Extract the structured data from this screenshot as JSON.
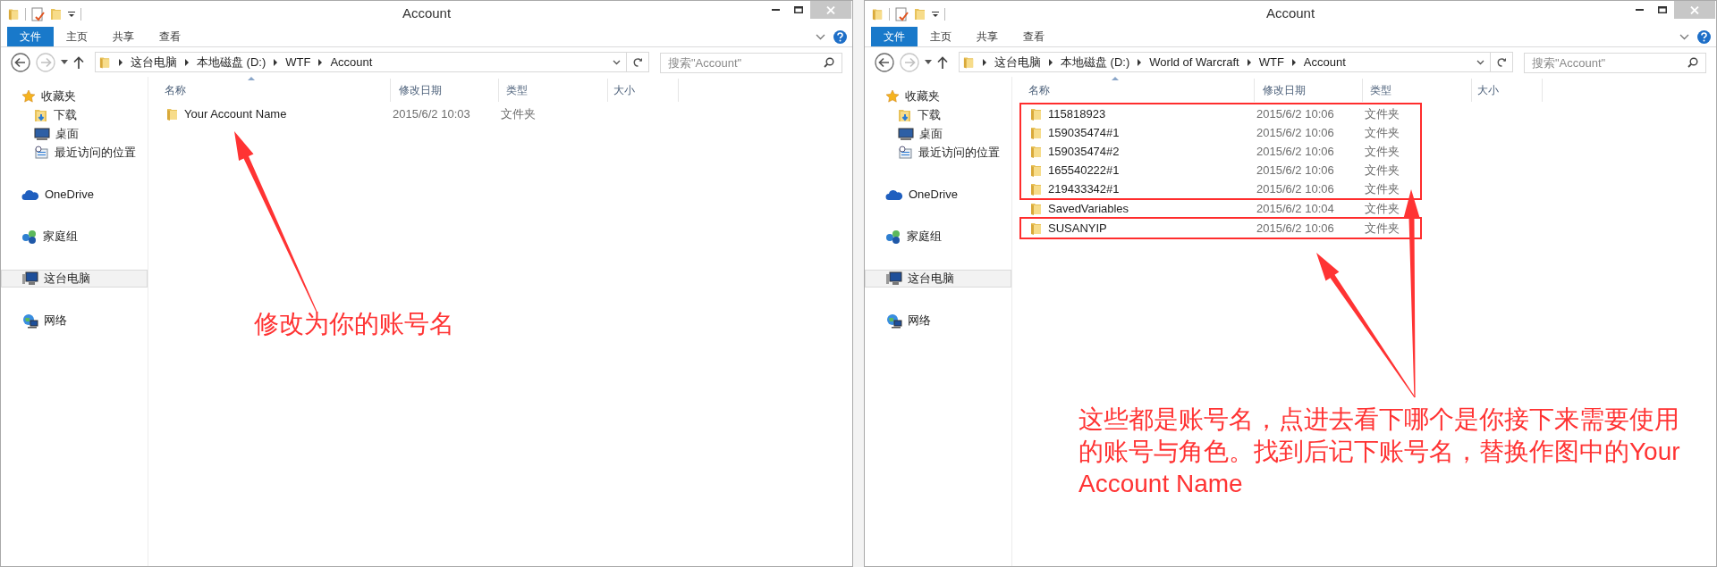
{
  "windows": [
    {
      "title": "Account",
      "ribbon_tabs": [
        {
          "label": "文件",
          "kind": "file"
        },
        {
          "label": "主页",
          "kind": "tab"
        },
        {
          "label": "共享",
          "kind": "tab"
        },
        {
          "label": "查看",
          "kind": "tab"
        }
      ],
      "path": [
        "这台电脑",
        "本地磁盘 (D:)",
        "WTF",
        "Account"
      ],
      "search": {
        "placeholder": "搜索\"Account\""
      },
      "columns": [
        "名称",
        "修改日期",
        "类型",
        "大小"
      ],
      "sidebar": [
        {
          "label": "收藏夹",
          "kind": "favorites",
          "selected": false,
          "children": [
            {
              "label": "下载",
              "kind": "downloads",
              "selected": false
            },
            {
              "label": "桌面",
              "kind": "desktop",
              "selected": false
            },
            {
              "label": "最近访问的位置",
              "kind": "recent",
              "selected": false
            }
          ]
        },
        {
          "label": "OneDrive",
          "kind": "cloud",
          "selected": false
        },
        {
          "label": "家庭组",
          "kind": "homegroup",
          "selected": false
        },
        {
          "label": "这台电脑",
          "kind": "computer",
          "selected": true
        },
        {
          "label": "网络",
          "kind": "network",
          "selected": false
        }
      ],
      "files": [
        {
          "name": "Your Account Name",
          "modified": "2015/6/2 10:03",
          "type": "文件夹",
          "boxed": false
        }
      ]
    },
    {
      "title": "Account",
      "ribbon_tabs": [
        {
          "label": "文件",
          "kind": "file"
        },
        {
          "label": "主页",
          "kind": "tab"
        },
        {
          "label": "共享",
          "kind": "tab"
        },
        {
          "label": "查看",
          "kind": "tab"
        }
      ],
      "path": [
        "这台电脑",
        "本地磁盘 (D:)",
        "World of Warcraft",
        "WTF",
        "Account"
      ],
      "search": {
        "placeholder": "搜索\"Account\""
      },
      "columns": [
        "名称",
        "修改日期",
        "类型",
        "大小"
      ],
      "sidebar": [
        {
          "label": "收藏夹",
          "kind": "favorites",
          "selected": false,
          "children": [
            {
              "label": "下载",
              "kind": "downloads",
              "selected": false
            },
            {
              "label": "桌面",
              "kind": "desktop",
              "selected": false
            },
            {
              "label": "最近访问的位置",
              "kind": "recent",
              "selected": false
            }
          ]
        },
        {
          "label": "OneDrive",
          "kind": "cloud",
          "selected": false
        },
        {
          "label": "家庭组",
          "kind": "homegroup",
          "selected": false
        },
        {
          "label": "这台电脑",
          "kind": "computer",
          "selected": true
        },
        {
          "label": "网络",
          "kind": "network",
          "selected": false
        }
      ],
      "files": [
        {
          "name": "115818923",
          "modified": "2015/6/2 10:06",
          "type": "文件夹",
          "boxed": true
        },
        {
          "name": "159035474#1",
          "modified": "2015/6/2 10:06",
          "type": "文件夹",
          "boxed": true
        },
        {
          "name": "159035474#2",
          "modified": "2015/6/2 10:06",
          "type": "文件夹",
          "boxed": true
        },
        {
          "name": "165540222#1",
          "modified": "2015/6/2 10:06",
          "type": "文件夹",
          "boxed": true
        },
        {
          "name": "219433342#1",
          "modified": "2015/6/2 10:06",
          "type": "文件夹",
          "boxed": true
        },
        {
          "name": "SavedVariables",
          "modified": "2015/6/2 10:04",
          "type": "文件夹",
          "boxed": false
        },
        {
          "name": "SUSANYIP",
          "modified": "2015/6/2 10:06",
          "type": "文件夹",
          "boxed": true
        }
      ]
    }
  ],
  "annotations": [
    {
      "text": "修改为你的账号名"
    },
    {
      "text": "这些都是账号名，点进去看下哪个是你接下来需要使用的账号与角色。找到后记下账号名，替换作图中的Your Account Name"
    }
  ]
}
